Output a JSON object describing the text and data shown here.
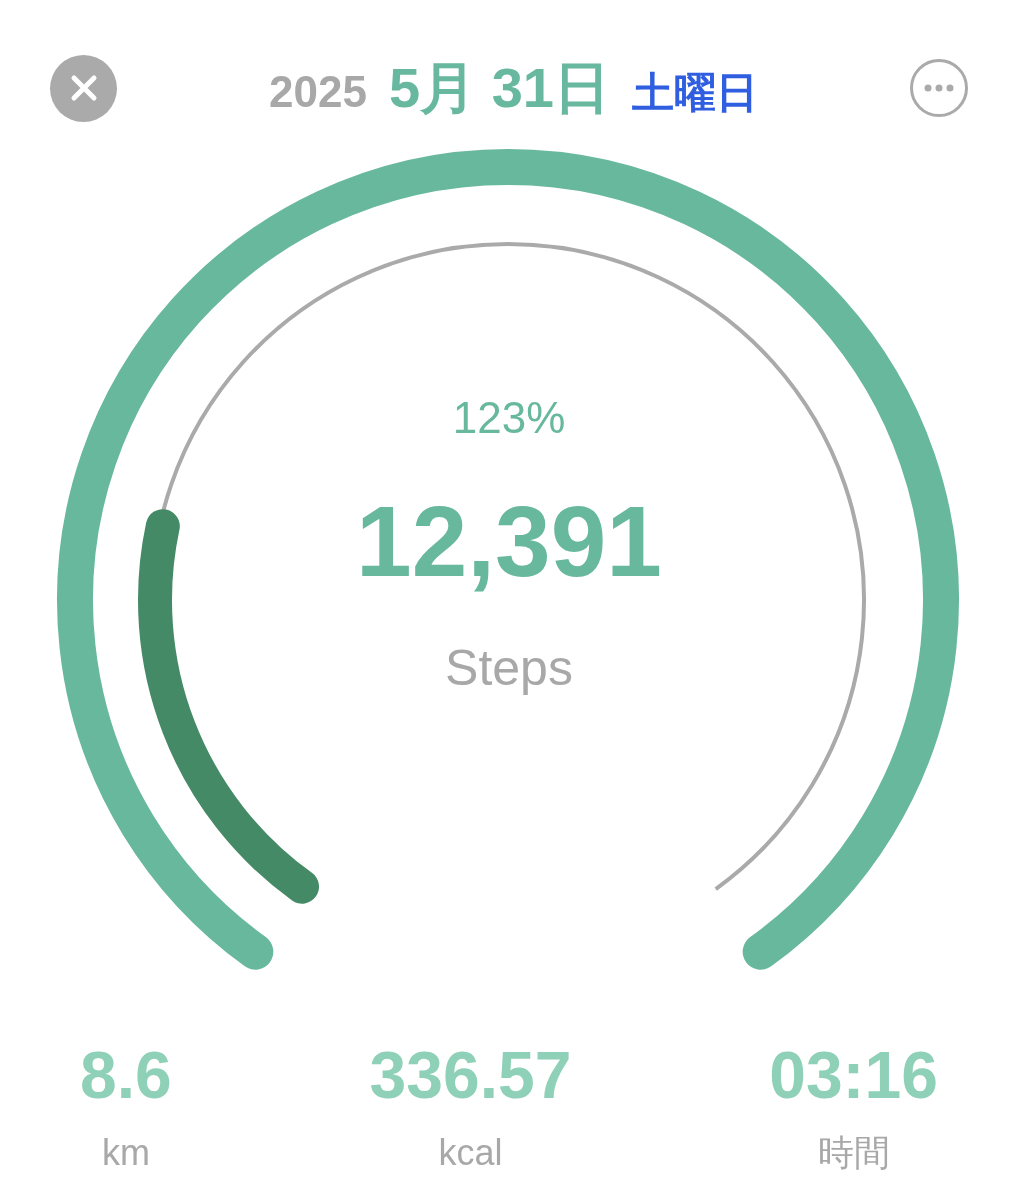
{
  "date": {
    "year": "2025",
    "month_day": "5月 31日",
    "weekday": "土曜日"
  },
  "gauge": {
    "percent": "123%",
    "value": "12,391",
    "unit": "Steps"
  },
  "stats": [
    {
      "value": "8.6",
      "unit": "km"
    },
    {
      "value": "336.57",
      "unit": "kcal"
    },
    {
      "value": "03:16",
      "unit": "時間"
    }
  ]
}
